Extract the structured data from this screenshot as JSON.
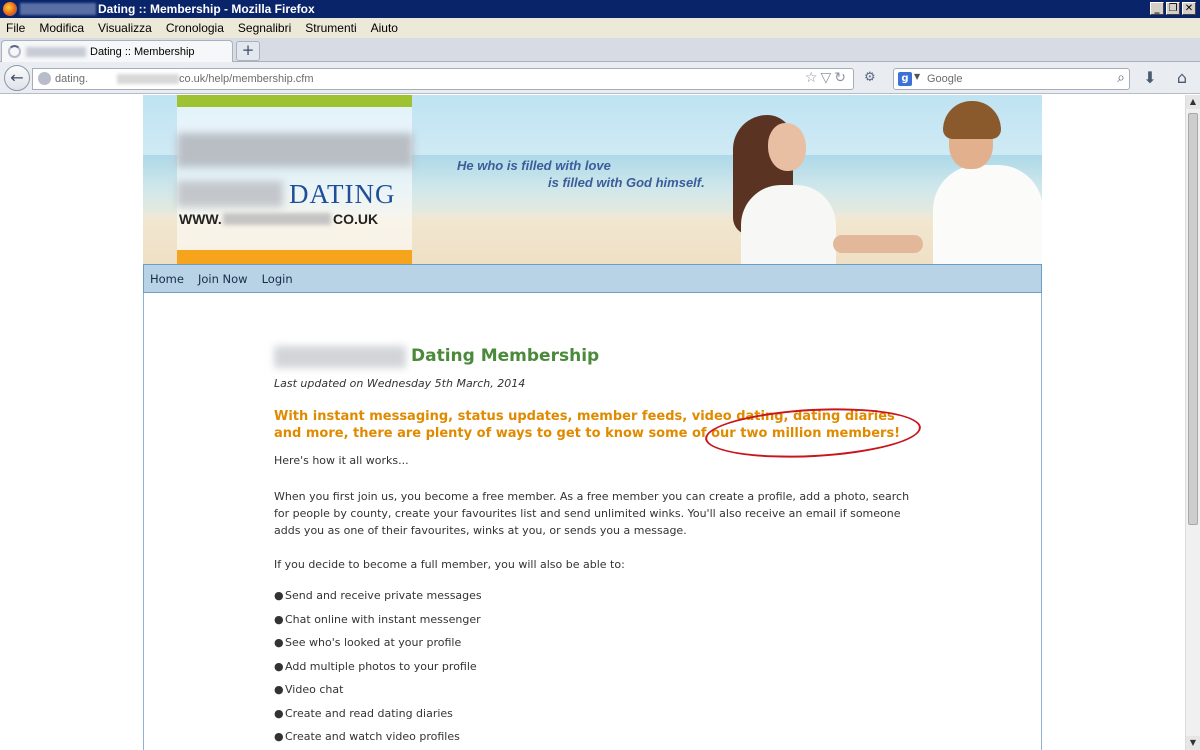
{
  "window": {
    "title": "Dating :: Membership - Mozilla Firefox",
    "buttons": [
      "_",
      "❐",
      "✕"
    ]
  },
  "menu": [
    "File",
    "Modifica",
    "Visualizza",
    "Cronologia",
    "Segnalibri",
    "Strumenti",
    "Aiuto"
  ],
  "tab": {
    "label": "Dating :: Membership",
    "new_tab_symbol": "+"
  },
  "nav": {
    "url_prefix": "dating.",
    "url_suffix": "co.uk/help/membership.cfm",
    "search_engine_letter": "g",
    "search_placeholder": "Google"
  },
  "site": {
    "logo_word": "DATING",
    "logo_www": "WWW.",
    "logo_domain_end": "CO.UK",
    "quote_line1": "He who is filled with love",
    "quote_line2": "is filled with God himself.",
    "nav_links": [
      "Home",
      "Join Now",
      "Login"
    ]
  },
  "content": {
    "title": "Dating Membership",
    "updated": "Last updated on Wednesday 5th March, 2014",
    "tagline": "With instant messaging, status updates, member feeds, video dating, dating diaries and more, there are plenty of ways to get to know some of our two million members!",
    "intro": "Here's how it all works...",
    "para1": "When you first join us, you become a free member. As a free member you can create a profile, add a photo, search for people by county, create your favourites list and send unlimited winks. You'll also receive an email if someone adds you as one of their favourites, winks at you, or sends you a message.",
    "para2": "If you decide to become a full member, you will also be able to:",
    "features": [
      "Send and receive private messages",
      "Chat online with instant messenger",
      "See who's looked at your profile",
      "Add multiple photos to your profile",
      "Video chat",
      "Create and read dating diaries",
      "Create and watch video profiles"
    ]
  },
  "colors": {
    "title_green": "#4a8a3a",
    "tagline_orange": "#e08a00",
    "annotation_red": "#c8141b",
    "nav_blue": "#b8d3e6"
  }
}
